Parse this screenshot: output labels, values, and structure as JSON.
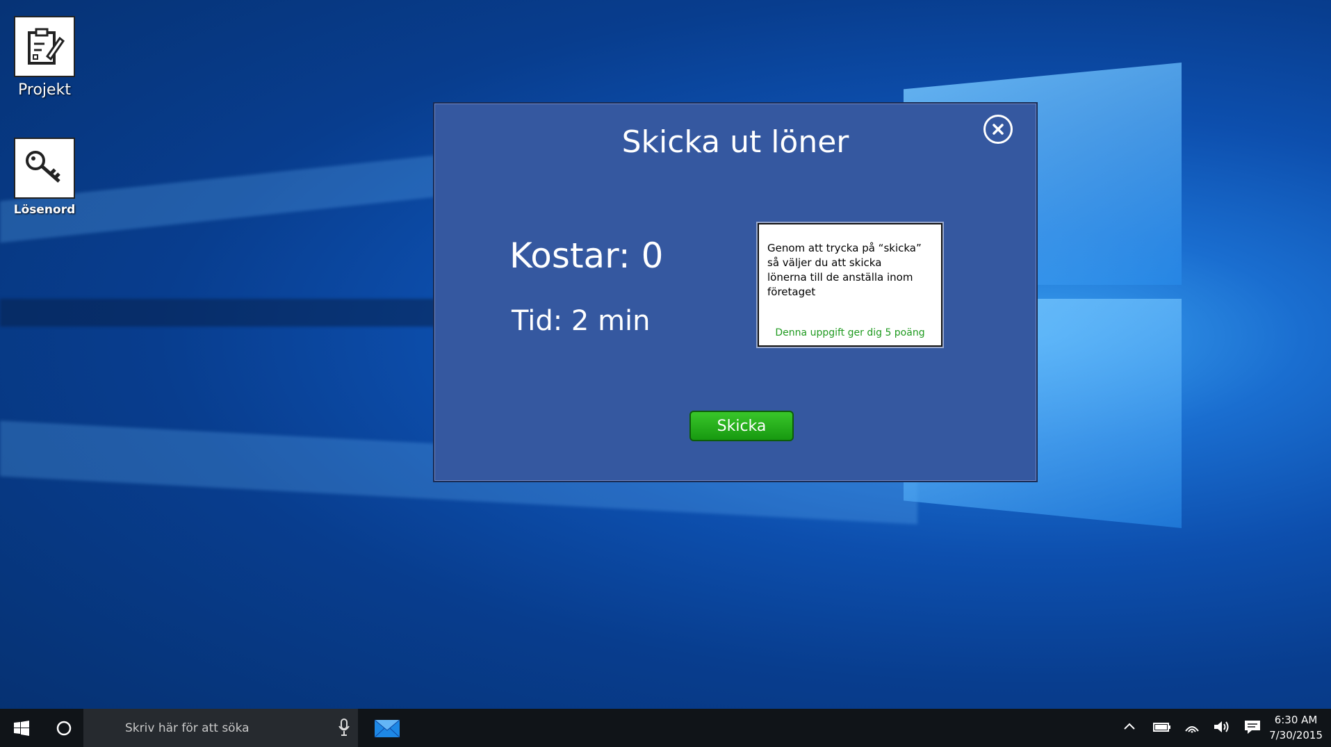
{
  "desktop": {
    "icons": [
      {
        "label": "Projekt"
      },
      {
        "label": "Lösenord"
      }
    ]
  },
  "dialog": {
    "title": "Skicka ut löner",
    "cost": "Kostar: 0",
    "time": "Tid: 2 min",
    "info_text": "Genom att trycka på “skicka” så väljer du att skicka\n lönerna till de anställa inom företaget",
    "info_points": "Denna uppgift ger dig 5 poäng",
    "send_label": "Skicka"
  },
  "taskbar": {
    "search_placeholder": "Skriv här för att söka",
    "time": "6:30 AM",
    "date": "7/30/2015"
  },
  "colors": {
    "dialog_bg": "#3558a0",
    "send_button": "#2bb11d",
    "points_text": "#1e9a1e"
  }
}
